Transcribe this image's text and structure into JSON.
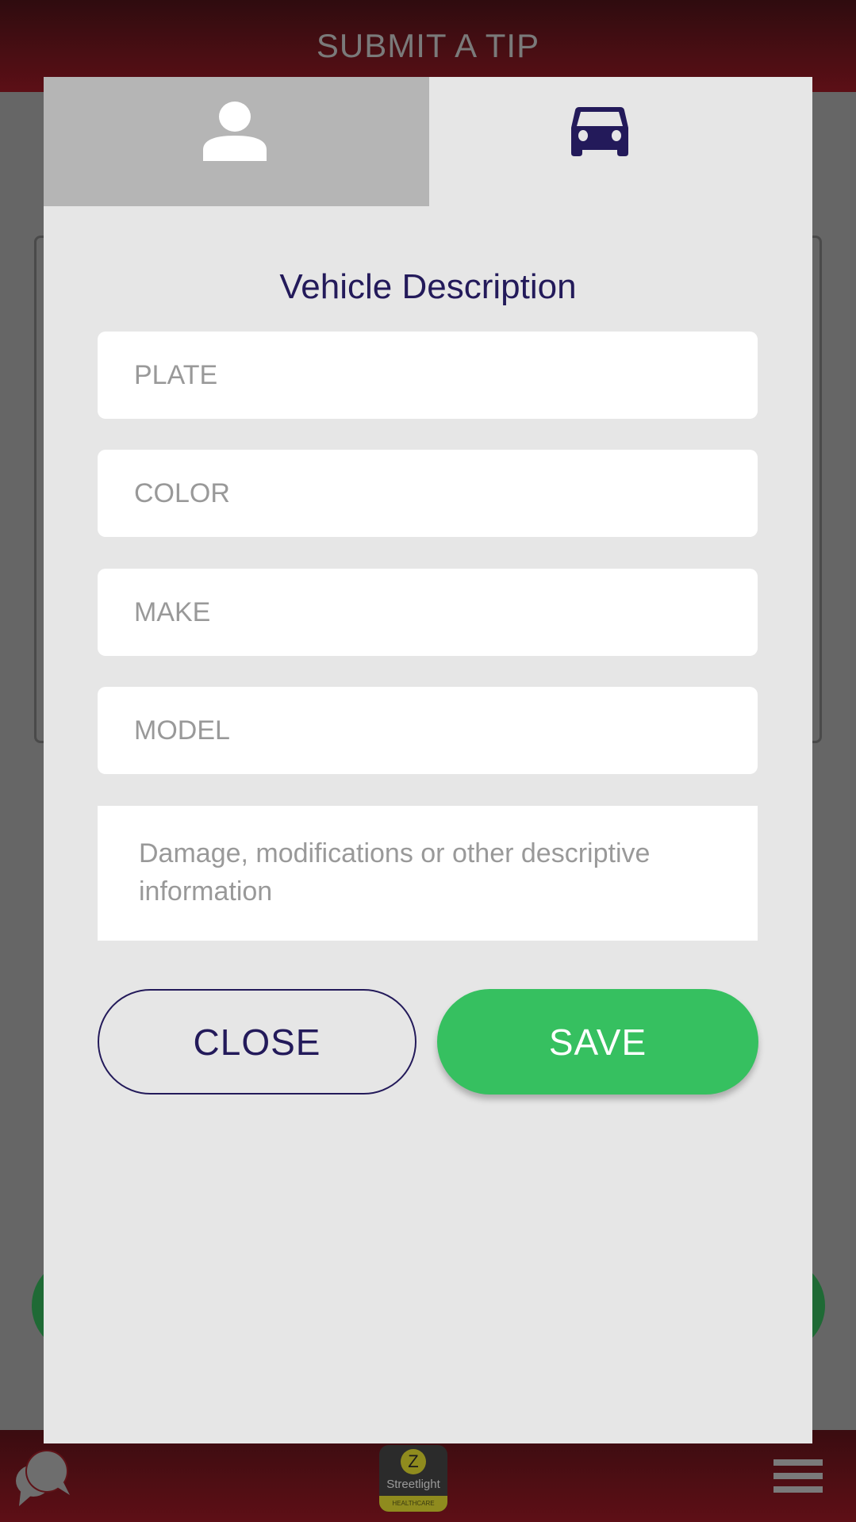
{
  "app": {
    "header_title": "SUBMIT A TIP",
    "footer": {
      "left_icon": "chat-bubbles-icon",
      "center_logo": {
        "letter": "Z",
        "name": "Streetlight",
        "tagline": "HEALTHCARE"
      },
      "right_icon": "hamburger-menu-icon"
    }
  },
  "modal": {
    "tabs": [
      {
        "name": "person",
        "icon": "person-icon",
        "active": false
      },
      {
        "name": "vehicle",
        "icon": "car-icon",
        "active": true
      }
    ],
    "title": "Vehicle Description",
    "fields": {
      "plate": {
        "value": "",
        "placeholder": "PLATE"
      },
      "color": {
        "value": "",
        "placeholder": "COLOR"
      },
      "make": {
        "value": "",
        "placeholder": "MAKE"
      },
      "model": {
        "value": "",
        "placeholder": "MODEL"
      },
      "details": {
        "value": "",
        "placeholder": "Damage, modifications or other descriptive information"
      }
    },
    "buttons": {
      "close": "CLOSE",
      "save": "SAVE"
    }
  },
  "colors": {
    "brand_dark_red": "#5c0f16",
    "accent_navy": "#231a5a",
    "save_green": "#36c060",
    "modal_bg": "#e6e6e6",
    "inactive_tab": "#b5b5b5"
  }
}
